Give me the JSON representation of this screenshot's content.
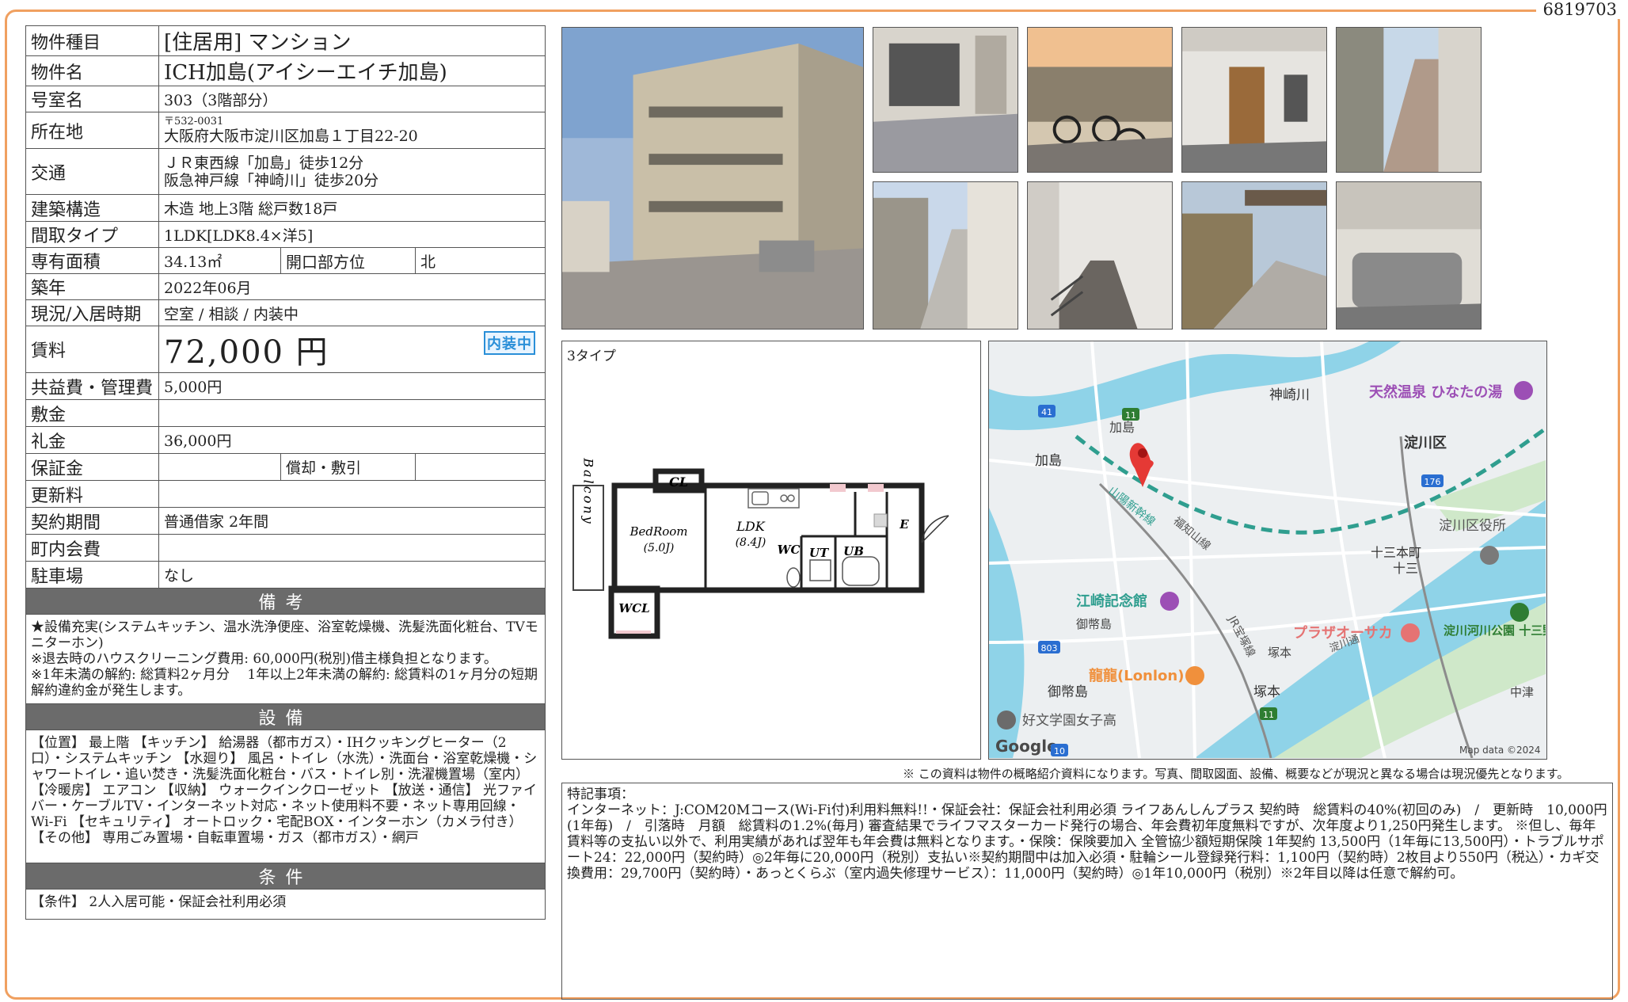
{
  "ref_no": "6819703",
  "spec": {
    "type": {
      "label": "物件種目",
      "value": "[住居用] マンション"
    },
    "name": {
      "label": "物件名",
      "value": "ICH加島(アイシーエイチ加島)"
    },
    "room": {
      "label": "号室名",
      "value": "303（3階部分）"
    },
    "address": {
      "label": "所在地",
      "postal": "〒532-0031",
      "value": "大阪府大阪市淀川区加島１丁目22-20"
    },
    "access": {
      "label": "交通",
      "line1": "ＪＲ東西線「加島」徒歩12分",
      "line2": "阪急神戸線「神崎川」徒歩20分"
    },
    "structure": {
      "label": "建築構造",
      "value": "木造 地上3階 総戸数18戸"
    },
    "layout": {
      "label": "間取タイプ",
      "value": "1LDK[LDK8.4×洋5]"
    },
    "area": {
      "label": "専有面積",
      "value": "34.13㎡",
      "dir_label": "開口部方位",
      "dir_value": "北"
    },
    "built": {
      "label": "築年",
      "value": "2022年06月"
    },
    "status": {
      "label": "現況/入居時期",
      "value": "空室 / 相談 / 内装中"
    },
    "rent": {
      "label": "賃料",
      "value": "72,000 円",
      "badge": "内装中"
    },
    "fee": {
      "label": "共益費・管理費",
      "value": "5,000円"
    },
    "deposit": {
      "label": "敷金",
      "value": ""
    },
    "key_money": {
      "label": "礼金",
      "value": "36,000円"
    },
    "guarantee": {
      "label": "保証金",
      "value": "",
      "sub_label": "償却・敷引",
      "sub_value": ""
    },
    "renewal": {
      "label": "更新料",
      "value": ""
    },
    "contract": {
      "label": "契約期間",
      "value": "普通借家 2年間"
    },
    "community": {
      "label": "町内会費",
      "value": ""
    },
    "parking": {
      "label": "駐車場",
      "value": "なし"
    }
  },
  "remarks": {
    "heading": "備考",
    "text": "★設備充実(システムキッチン、温水洗浄便座、浴室乾燥機、洗髪洗面化粧台、TVモニターホン)\n※退去時のハウスクリーニング費用: 60,000円(税別)借主様負担となります。\n※1年未満の解約: 総賃料2ヶ月分　 1年以上2年未満の解約: 総賃料の1ヶ月分の短期解約違約金が発生します。"
  },
  "equipment": {
    "heading": "設備",
    "text": "【位置】 最上階 【キッチン】 給湯器（都市ガス）・IHクッキングヒーター（2口）・システムキッチン 【水廻り】 風呂・トイレ（水洗）・洗面台・浴室乾燥機・シャワートイレ・追い焚き・洗髪洗面化粧台・バス・トイレ別・洗濯機置場（室内） 【冷暖房】 エアコン 【収納】 ウォークインクローゼット 【放送・通信】 光ファイバー・ケーブルTV・インターネット対応・ネット使用料不要・ネット専用回線・Wi-Fi 【セキュリティ】 オートロック・宅配BOX・インターホン（カメラ付き） 【その他】 専用ごみ置場・自転車置場・ガス（都市ガス）・網戸"
  },
  "conditions": {
    "heading": "条件",
    "text": "【条件】 2人入居可能・保証会社利用必須"
  },
  "floorplan": {
    "title": "3タイプ",
    "rooms": {
      "balcony": "Balcony",
      "cl": "CL",
      "bedroom": "BedRoom",
      "bedroom_size": "(5.0J)",
      "ldk": "LDK",
      "ldk_size": "(8.4J)",
      "wc": "WC",
      "ut": "UT",
      "ub": "UB",
      "e": "E",
      "wcl": "WCL"
    }
  },
  "map": {
    "labels": {
      "kanzakigawa": "神崎川",
      "onsen": "天然温泉 ひなたの湯",
      "kashima_area": "加島",
      "kashima_st": "加島",
      "yodogawa_ku": "淀川区",
      "shinkansen": "山陽新幹線",
      "fukuchiyama": "福知山線",
      "ward_office": "淀川区役所",
      "juso_honmachi": "十三本町",
      "juso": "十三",
      "edosaki": "江崎記念館",
      "mitejima_area": "御幣島",
      "plaza": "プラザオーサカ",
      "yodogawa_dori": "淀川通",
      "park": "淀川河川公園 十三野草地区",
      "jr_line": "JR宝塚線",
      "tsukamoto": "塚本",
      "tsukamoto_st": "塚本",
      "lonlon": "龍龍(Lonlon)",
      "mitejima_st": "御幣島",
      "nakatsu": "中津",
      "school": "好文学園女子高",
      "google": "Google",
      "mapdata": "Map data ©2024",
      "r41": "41",
      "r11a": "11",
      "r176": "176",
      "r803": "803",
      "r11b": "11",
      "r10": "10"
    }
  },
  "disclaimer": "※ この資料は物件の概略紹介資料になります。写真、間取図面、設備、概要などが現況と異なる場合は現況優先となります。",
  "notes": "特記事項：\nインターネット：J:COM20Mコース(Wi-Fi付)利用料無料!!・保証会社：保証会社利用必須 ライフあんしんプラス 契約時　総賃料の40%(初回のみ)　/　更新時　10,000円(1年毎)　/　引落時　月額　総賃料の1.2%(毎月) 審査結果でライフマスターカード発行の場合、年会費初年度無料ですが、次年度より1,250円発生します。 ※但し、毎年賃料等の支払い以外で、利用実績があれば翌年も年会費は無料となります。・保険：保険要加入 全管協少額短期保険 1年契約 13,500円（1年毎に13,500円）・トラブルサポート24：22,000円（契約時）◎2年毎に20,000円（税別）支払い※契約期間中は加入必須・駐輪シール登録発行料：1,100円（契約時）2枚目より550円（税込）・カギ交換費用：29,700円（契約時）・あっとくらぶ（室内過失修理サービス）：11,000円（契約時）◎1年10,000円（税別）※2年目以降は任意で解約可。",
  "colors": {
    "frame": "#f0a060",
    "section": "#6b6b6b",
    "badge": "#2a8fd8",
    "river": "#8fd3e8",
    "map_bg": "#eceff1",
    "pin": "#e53935"
  }
}
